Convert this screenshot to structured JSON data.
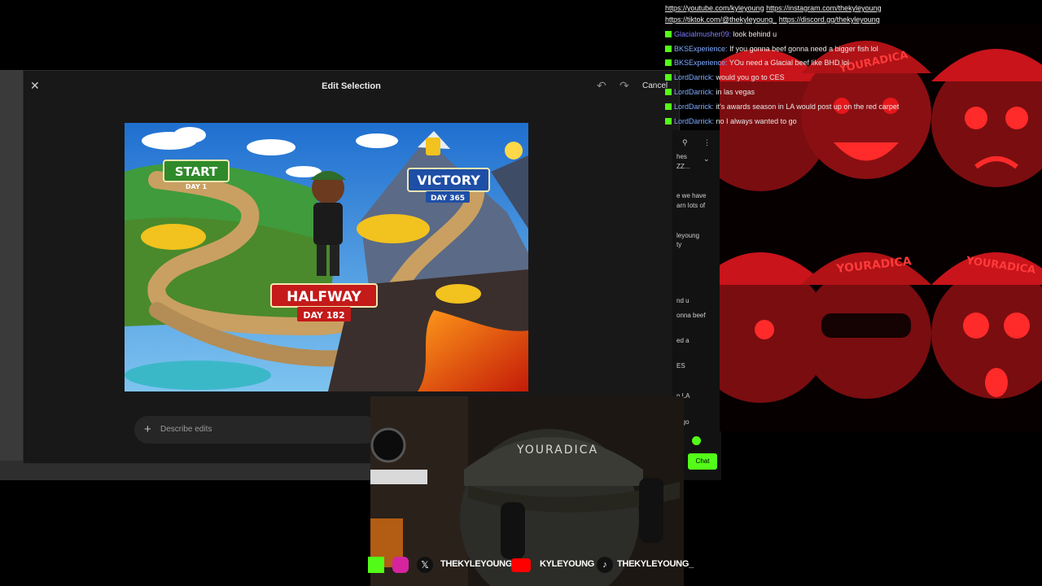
{
  "dialog": {
    "title": "Edit Selection",
    "cancel_label": "Cancel",
    "prompt_placeholder": "Describe edits"
  },
  "artwork": {
    "start_label": "START",
    "start_day": "DAY 1",
    "victory_label": "VICTORY",
    "victory_day": "DAY 365",
    "halfway_label": "HALFWAY",
    "halfway_day": "DAY 182"
  },
  "chat": {
    "links": [
      "https://youtube.com/kyleyoung",
      "https://instagram.com/thekyleyoung",
      "https://tiktok.com/@thekyleyoung_",
      "https://discord.gg/thekyleyoung"
    ],
    "messages": [
      {
        "user": "Glacialmusher09:",
        "text": "look behind u"
      },
      {
        "user": "BKSExperience:",
        "text": "If you gonna beef gonna need a bigger fish lol"
      },
      {
        "user": "BKSExperience:",
        "text": "YOu need a Glacial beef like BHD lol"
      },
      {
        "user": "LordDarrick:",
        "text": "would you go to CES"
      },
      {
        "user": "LordDarrick:",
        "text": "in las vegas"
      },
      {
        "user": "LordDarrick:",
        "text": "it's awards season in LA would post up on the red carpet"
      },
      {
        "user": "LordDarrick:",
        "text": "no I always wanted to go"
      }
    ],
    "panel_fragments": [
      "hes",
      "ZZ...",
      "e we have",
      "arn lots of",
      "leyoung",
      "ty",
      "nd u",
      "onna beef",
      "ed a",
      "ES",
      "n LA",
      "o go"
    ],
    "chat_button_label": "Chat"
  },
  "emote_wall": {
    "cap_text": "YOURADICA"
  },
  "webcam": {
    "cap_text": "YOURADICA"
  },
  "social": {
    "x_handle": "THEKYLEYOUNG",
    "youtube_handle": "KYLEYOUNG",
    "tiktok_handle": "THEKYLEYOUNG_"
  },
  "colors": {
    "kick_green": "#53fc18",
    "emote_red": "#c8141a",
    "dialog_bg": "#181818"
  }
}
